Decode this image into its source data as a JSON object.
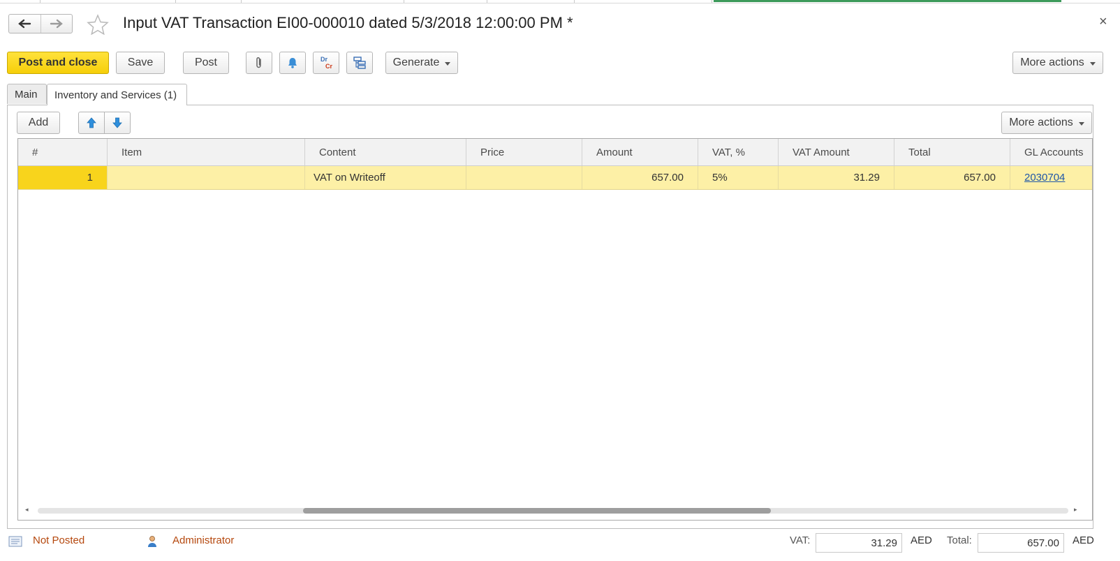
{
  "window": {
    "title": "Input VAT Transaction EI00-000010 dated 5/3/2018 12:00:00 PM *",
    "close_symbol": "×"
  },
  "toolbar": {
    "post_and_close": "Post and close",
    "save": "Save",
    "post": "Post",
    "dr_label": "Dr",
    "cr_label": "Cr",
    "generate": "Generate",
    "more_actions": "More actions"
  },
  "tabs": [
    {
      "label": "Main",
      "active": false
    },
    {
      "label": "Inventory and Services (1)",
      "active": true
    }
  ],
  "table_toolbar": {
    "add": "Add",
    "more_actions": "More actions"
  },
  "table": {
    "columns": [
      "#",
      "Item",
      "Content",
      "Price",
      "Amount",
      "VAT, %",
      "VAT Amount",
      "Total",
      "GL Accounts"
    ],
    "rows": [
      {
        "num": "1",
        "item": "",
        "content": "VAT on Writeoff",
        "price": "",
        "amount": "657.00",
        "vat_rate": "5%",
        "vat_amount": "31.29",
        "total": "657.00",
        "gl_accounts": "2030704"
      }
    ]
  },
  "footer": {
    "status": "Not Posted",
    "author": "Administrator",
    "vat_label": "VAT:",
    "vat_value": "31.29",
    "vat_currency": "AED",
    "total_label": "Total:",
    "total_value": "657.00",
    "total_currency": "AED"
  },
  "colors": {
    "primary_button": "#f6cf0a",
    "selected_row": "#fdf0a6",
    "row_number_cell": "#f8d41c",
    "link": "#1f57a8",
    "status_text": "#b5480e"
  }
}
